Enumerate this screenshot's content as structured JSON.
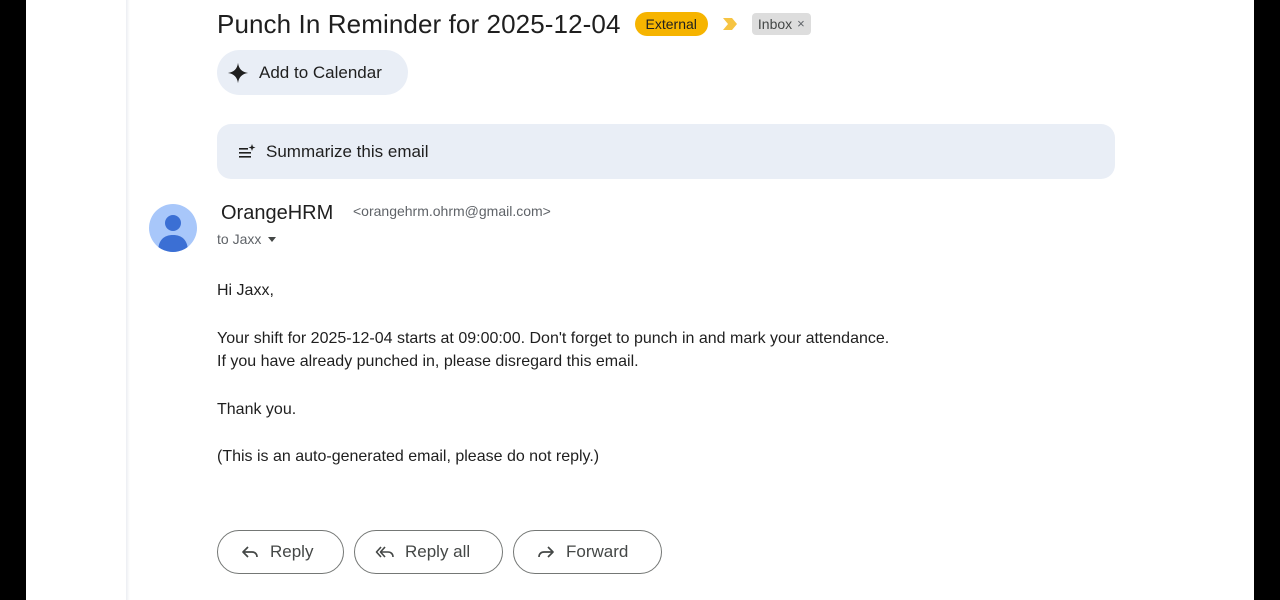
{
  "email": {
    "subject": "Punch In Reminder for 2025-12-04",
    "labels": {
      "external": "External",
      "inbox": "Inbox",
      "inbox_remove": "×"
    },
    "add_to_calendar": "Add to Calendar",
    "summarize": "Summarize this email",
    "sender": {
      "name": "OrangeHRM",
      "email": "<orangehrm.ohrm@gmail.com>"
    },
    "to": "to Jaxx",
    "body": {
      "greeting": "Hi Jaxx,",
      "line1": "Your shift for 2025-12-04 starts at 09:00:00. Don't forget to punch in and mark your attendance.",
      "line2": "If you have already punched in, please disregard this email.",
      "thanks": "Thank you.",
      "footer": "(This is an auto-generated email, please do not reply.)"
    },
    "actions": {
      "reply": "Reply",
      "reply_all": "Reply all",
      "forward": "Forward"
    }
  },
  "icons": {
    "calendar_chip": "sparkle-icon",
    "summarize": "summarize-icon",
    "importance": "importance-marker-icon",
    "to_caret": "caret-down-icon",
    "reply": "reply-icon",
    "reply_all": "reply-all-icon",
    "forward": "forward-icon"
  },
  "colors": {
    "external_badge": "#f6b400",
    "importance_marker": "#f6c443",
    "chip_background": "#e9eef6",
    "avatar_background": "#a8c7fa",
    "avatar_figure": "#3b6fd4"
  }
}
